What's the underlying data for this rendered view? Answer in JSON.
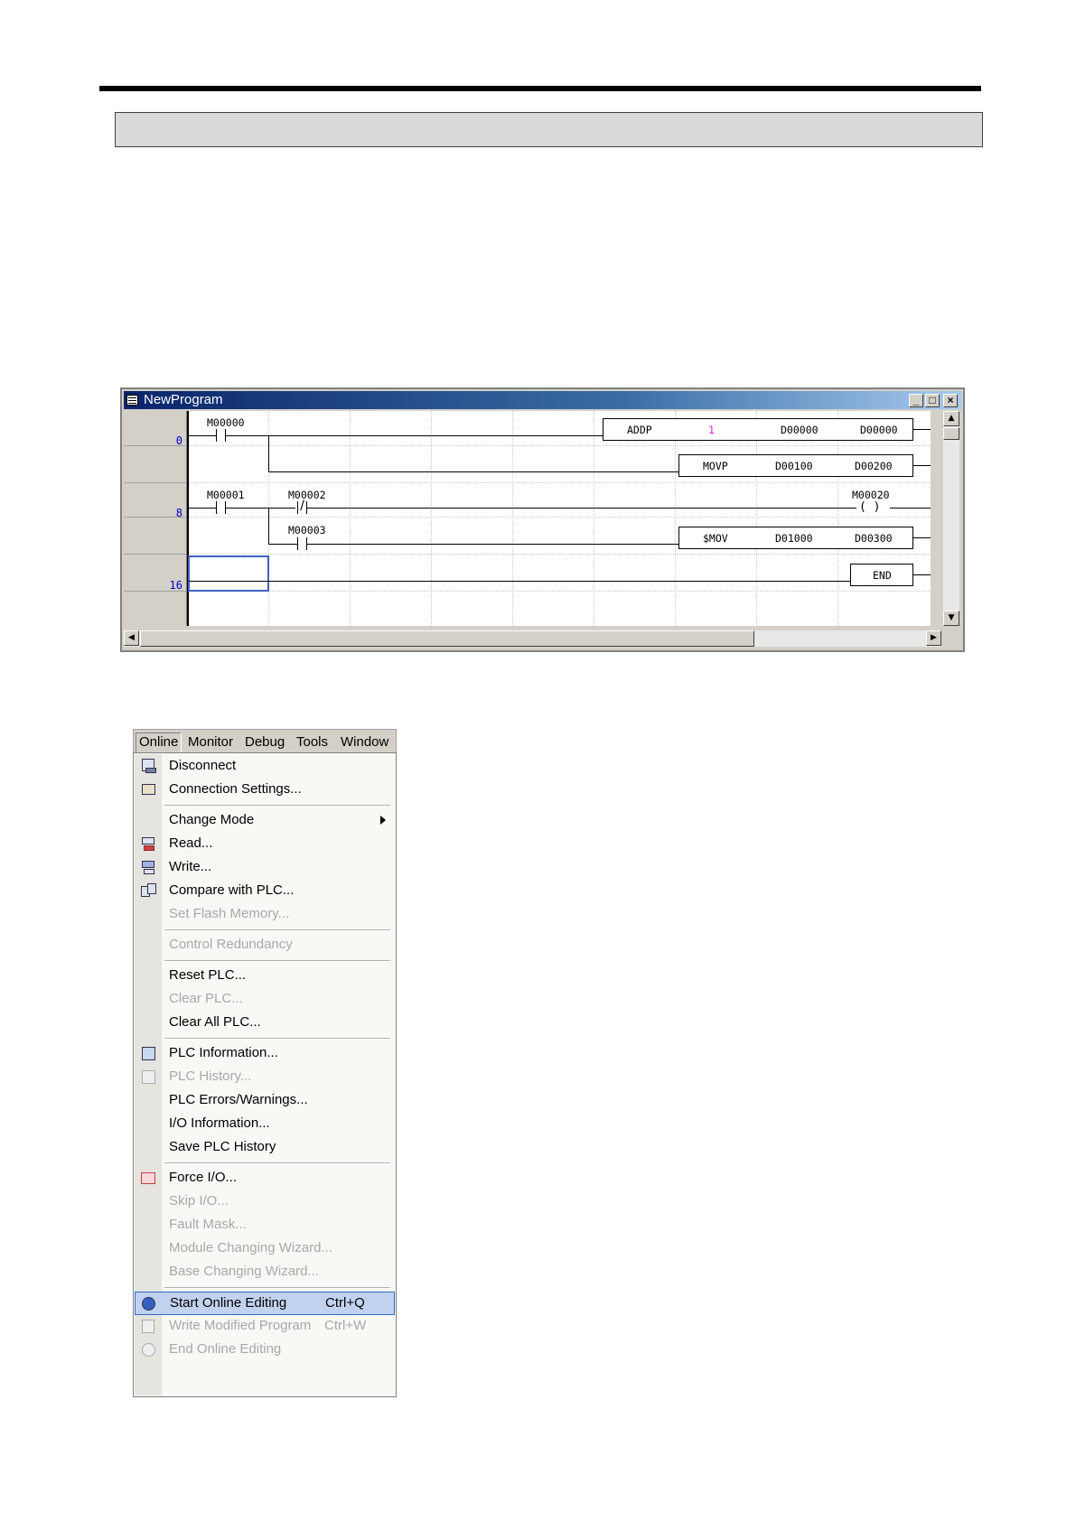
{
  "window": {
    "title": "NewProgram",
    "caption_buttons": [
      "_",
      "□",
      "×"
    ]
  },
  "ladder": {
    "rung_numbers": [
      "0",
      "8",
      "16"
    ],
    "rung0": {
      "contact": "M00000",
      "addp": {
        "op": "ADDP",
        "s1": "1",
        "s2": "D00000",
        "d": "D00000"
      },
      "movp": {
        "op": "MOVP",
        "s": "D00100",
        "d": "D00200"
      }
    },
    "rung8": {
      "contact1": "M00001",
      "contact2": "M00002",
      "coil": "M00020",
      "coil_symbol": "( )",
      "contact3": "M00003",
      "smov": {
        "op": "$MOV",
        "s": "D01000",
        "d": "D00300"
      }
    },
    "rung16": {
      "end": "END"
    }
  },
  "colors": {
    "constant": "#e020e0",
    "rung_number": "#0000c0",
    "highlight": "#c1d2ee"
  },
  "menubar": {
    "items": [
      "Online",
      "Monitor",
      "Debug",
      "Tools",
      "Window"
    ]
  },
  "menu": {
    "items": [
      {
        "label": "Disconnect",
        "enabled": true,
        "icon": "disconnect-icon"
      },
      {
        "label": "Connection Settings...",
        "enabled": true,
        "icon": "connection-settings-icon"
      },
      {
        "label": "Change Mode",
        "enabled": true,
        "submenu": true
      },
      {
        "label": "Read...",
        "enabled": true,
        "icon": "read-icon"
      },
      {
        "label": "Write...",
        "enabled": true,
        "icon": "write-icon"
      },
      {
        "label": "Compare with PLC...",
        "enabled": true,
        "icon": "compare-icon"
      },
      {
        "label": "Set Flash Memory...",
        "enabled": false
      },
      {
        "label": "Control Redundancy",
        "enabled": false
      },
      {
        "label": "Reset PLC...",
        "enabled": true
      },
      {
        "label": "Clear PLC...",
        "enabled": false
      },
      {
        "label": "Clear All PLC...",
        "enabled": true
      },
      {
        "label": "PLC Information...",
        "enabled": true,
        "icon": "plc-information-icon"
      },
      {
        "label": "PLC History...",
        "enabled": false,
        "icon": "plc-history-icon"
      },
      {
        "label": "PLC Errors/Warnings...",
        "enabled": true
      },
      {
        "label": "I/O Information...",
        "enabled": true
      },
      {
        "label": "Save PLC History",
        "enabled": true
      },
      {
        "label": "Force I/O...",
        "enabled": true,
        "icon": "force-io-icon"
      },
      {
        "label": "Skip I/O...",
        "enabled": false
      },
      {
        "label": "Fault Mask...",
        "enabled": false
      },
      {
        "label": "Module Changing Wizard...",
        "enabled": false
      },
      {
        "label": "Base Changing Wizard...",
        "enabled": false
      },
      {
        "label": "Start Online Editing",
        "shortcut": "Ctrl+Q",
        "enabled": true,
        "highlighted": true,
        "icon": "start-online-editing-icon"
      },
      {
        "label": "Write Modified Program",
        "shortcut": "Ctrl+W",
        "enabled": false,
        "icon": "write-modified-program-icon"
      },
      {
        "label": "End Online Editing",
        "enabled": false,
        "icon": "end-online-editing-icon"
      }
    ]
  }
}
